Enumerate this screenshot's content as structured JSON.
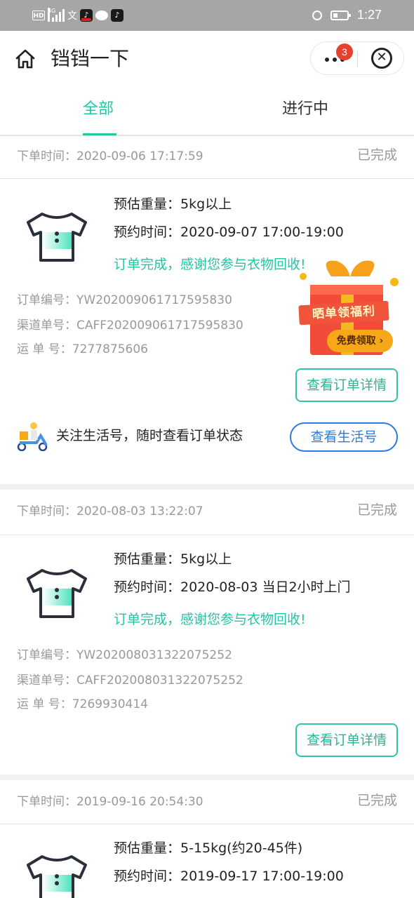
{
  "status_bar": {
    "hd": "HD",
    "network": "4G",
    "input_glyph": "文",
    "time": "1:27"
  },
  "nav": {
    "title": "铛铛一下",
    "badge_count": "3"
  },
  "tabs": [
    {
      "label": "全部",
      "active": true
    },
    {
      "label": "进行中",
      "active": false
    }
  ],
  "orders": [
    {
      "order_time": "下单时间：2020-09-06 17:17:59",
      "status": "已完成",
      "weight": "预估重量：5kg以上",
      "appointment": "预约时间：2020-09-07 17:00-19:00",
      "message": "订单完成，感谢您参与衣物回收!",
      "order_no": "订单编号：YW202009061717595830",
      "channel_no": "渠道单号：CAFF202009061717595830",
      "waybill": "运  单  号：7277875606",
      "detail_button": "查看订单详情"
    },
    {
      "order_time": "下单时间：2020-08-03 13:22:07",
      "status": "已完成",
      "weight": "预估重量：5kg以上",
      "appointment": "预约时间：2020-08-03 当日2小时上门",
      "message": "订单完成，感谢您参与衣物回收!",
      "order_no": "订单编号：YW202008031322075252",
      "channel_no": "渠道单号：CAFF202008031322075252",
      "waybill": "运  单  号：7269930414",
      "detail_button": "查看订单详情"
    },
    {
      "order_time": "下单时间：2019-09-16 20:54:30",
      "status": "已完成",
      "weight": "预估重量：5-15kg(约20-45件)",
      "appointment": "预约时间：2019-09-17 17:00-19:00"
    }
  ],
  "follow": {
    "text": "关注生活号，随时查看订单状态",
    "button": "查看生活号"
  },
  "gift": {
    "banner": "晒单领福利",
    "pill": "免费领取 ›"
  },
  "colors": {
    "accent": "#21c6a3",
    "follow_blue": "#2c7be5",
    "badge_red": "#e8402f"
  }
}
